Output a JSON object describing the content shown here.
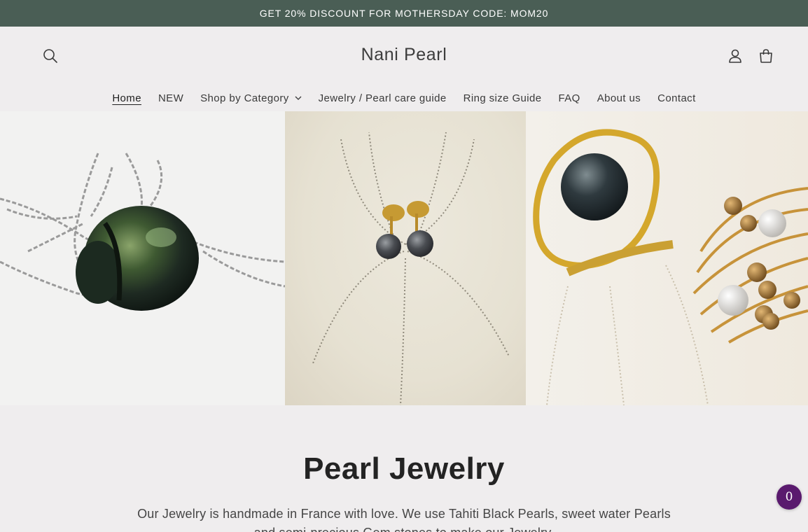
{
  "announcement": {
    "text": "GET 20% DISCOUNT FOR MOTHERSDAY CODE: MOM20"
  },
  "header": {
    "logo": "Nani Pearl",
    "icons": [
      "search-icon",
      "account-icon",
      "cart-icon"
    ]
  },
  "nav": {
    "items": [
      {
        "label": "Home",
        "active": true
      },
      {
        "label": "NEW"
      },
      {
        "label": "Shop by Category",
        "dropdown": true
      },
      {
        "label": "Jewelry / Pearl care guide"
      },
      {
        "label": "Ring size Guide"
      },
      {
        "label": "FAQ"
      },
      {
        "label": "About us"
      },
      {
        "label": "Contact"
      }
    ]
  },
  "hero": {
    "images": [
      "black-pearl-necklace-image",
      "pearl-stud-earrings-image",
      "pearl-rings-image"
    ]
  },
  "intro": {
    "title": "Pearl Jewelry",
    "description": "Our Jewelry is handmade in France with love. We use Tahiti Black Pearls, sweet water Pearls and semi-precious Gem stones to make our Jewelry."
  },
  "chat": {
    "count": "0",
    "color": "#5a1a6e"
  },
  "colors": {
    "announcement_bg": "#4a5e55",
    "page_bg": "#efedee"
  }
}
